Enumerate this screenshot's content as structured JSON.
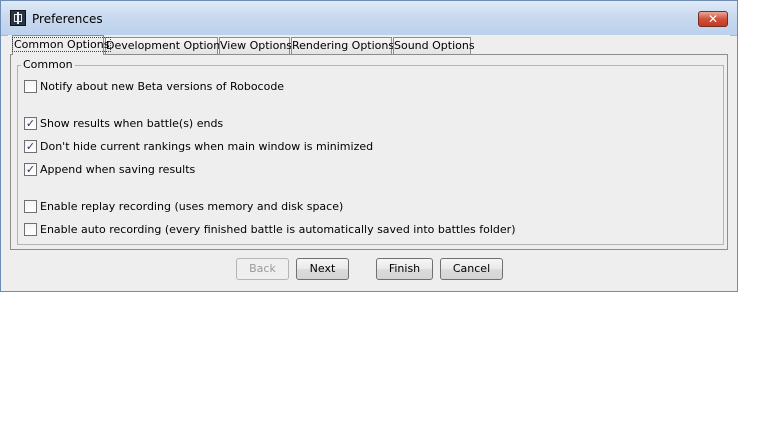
{
  "window": {
    "title": "Preferences",
    "close_icon": "close-icon"
  },
  "tabs": [
    {
      "label": "Common Options",
      "active": true
    },
    {
      "label": "Development Options",
      "active": false
    },
    {
      "label": "View Options",
      "active": false
    },
    {
      "label": "Rendering Options",
      "active": false
    },
    {
      "label": "Sound Options",
      "active": false
    }
  ],
  "group": {
    "title": "Common",
    "options": [
      {
        "label": "Notify about new Beta versions of Robocode",
        "checked": false
      },
      {
        "label": "Show results when battle(s) ends",
        "checked": true
      },
      {
        "label": "Don't hide current rankings when main window is minimized",
        "checked": true
      },
      {
        "label": "Append when saving results",
        "checked": true
      },
      {
        "label": "Enable replay recording (uses memory and disk space)",
        "checked": false
      },
      {
        "label": "Enable auto recording (every finished battle is automatically saved into battles folder)",
        "checked": false
      }
    ]
  },
  "buttons": {
    "back": "Back",
    "next": "Next",
    "finish": "Finish",
    "cancel": "Cancel"
  },
  "check_glyph": "✓"
}
